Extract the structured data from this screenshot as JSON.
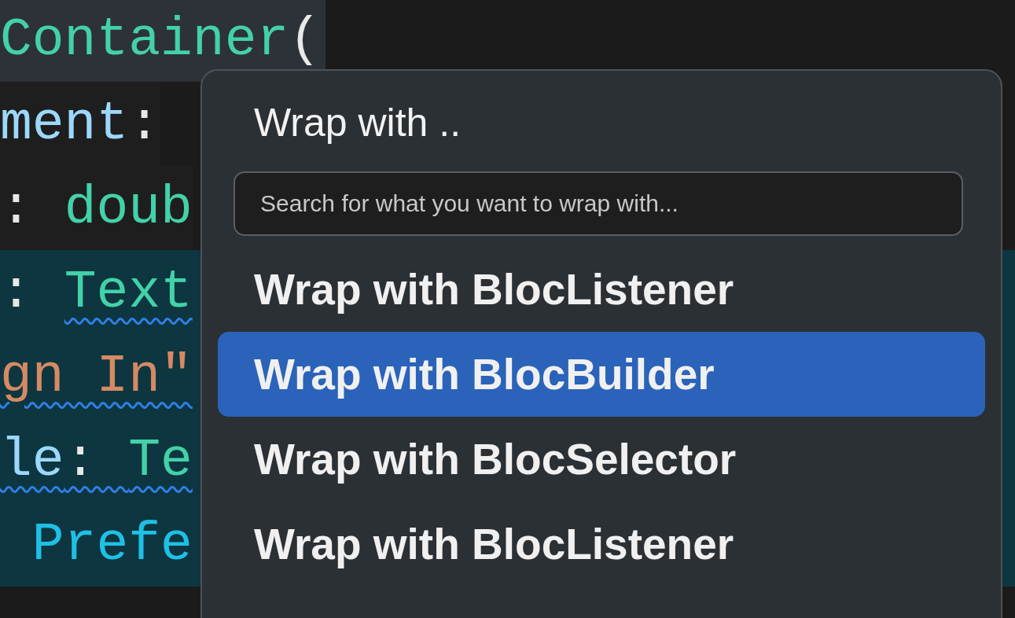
{
  "editor": {
    "lines": [
      {
        "current": true,
        "selected": false,
        "segments": [
          {
            "text": "Container",
            "kind": "type",
            "squiggle": false
          },
          {
            "text": "(",
            "kind": "punct",
            "squiggle": false
          }
        ]
      },
      {
        "current": false,
        "selected": false,
        "segments": [
          {
            "text": "ment",
            "kind": "property",
            "squiggle": false
          },
          {
            "text": ":",
            "kind": "punct",
            "squiggle": false
          }
        ]
      },
      {
        "current": false,
        "selected": false,
        "segments": [
          {
            "text": ": ",
            "kind": "punct",
            "squiggle": false
          },
          {
            "text": "doub",
            "kind": "type",
            "squiggle": false
          }
        ]
      },
      {
        "current": false,
        "selected": true,
        "segments": [
          {
            "text": ": ",
            "kind": "punct",
            "squiggle": false
          },
          {
            "text": "Text",
            "kind": "type",
            "squiggle": true
          }
        ]
      },
      {
        "current": false,
        "selected": true,
        "segments": [
          {
            "text": "gn In\"",
            "kind": "string",
            "squiggle": true
          }
        ]
      },
      {
        "current": false,
        "selected": true,
        "segments": [
          {
            "text": "le",
            "kind": "property",
            "squiggle": true
          },
          {
            "text": ": ",
            "kind": "punct",
            "squiggle": true
          },
          {
            "text": "Te",
            "kind": "type",
            "squiggle": true
          }
        ]
      },
      {
        "current": false,
        "selected": true,
        "segments": [
          {
            "text": " Prefe",
            "kind": "constant",
            "squiggle": false
          }
        ]
      }
    ]
  },
  "popup": {
    "title": "Wrap with ..",
    "search": {
      "placeholder": "Search for what you want to wrap with..."
    },
    "items": [
      {
        "label": "Wrap with BlocListener",
        "selected": false
      },
      {
        "label": "Wrap with BlocBuilder",
        "selected": true
      },
      {
        "label": "Wrap with BlocSelector",
        "selected": false
      },
      {
        "label": "Wrap with BlocListener",
        "selected": false
      }
    ]
  }
}
